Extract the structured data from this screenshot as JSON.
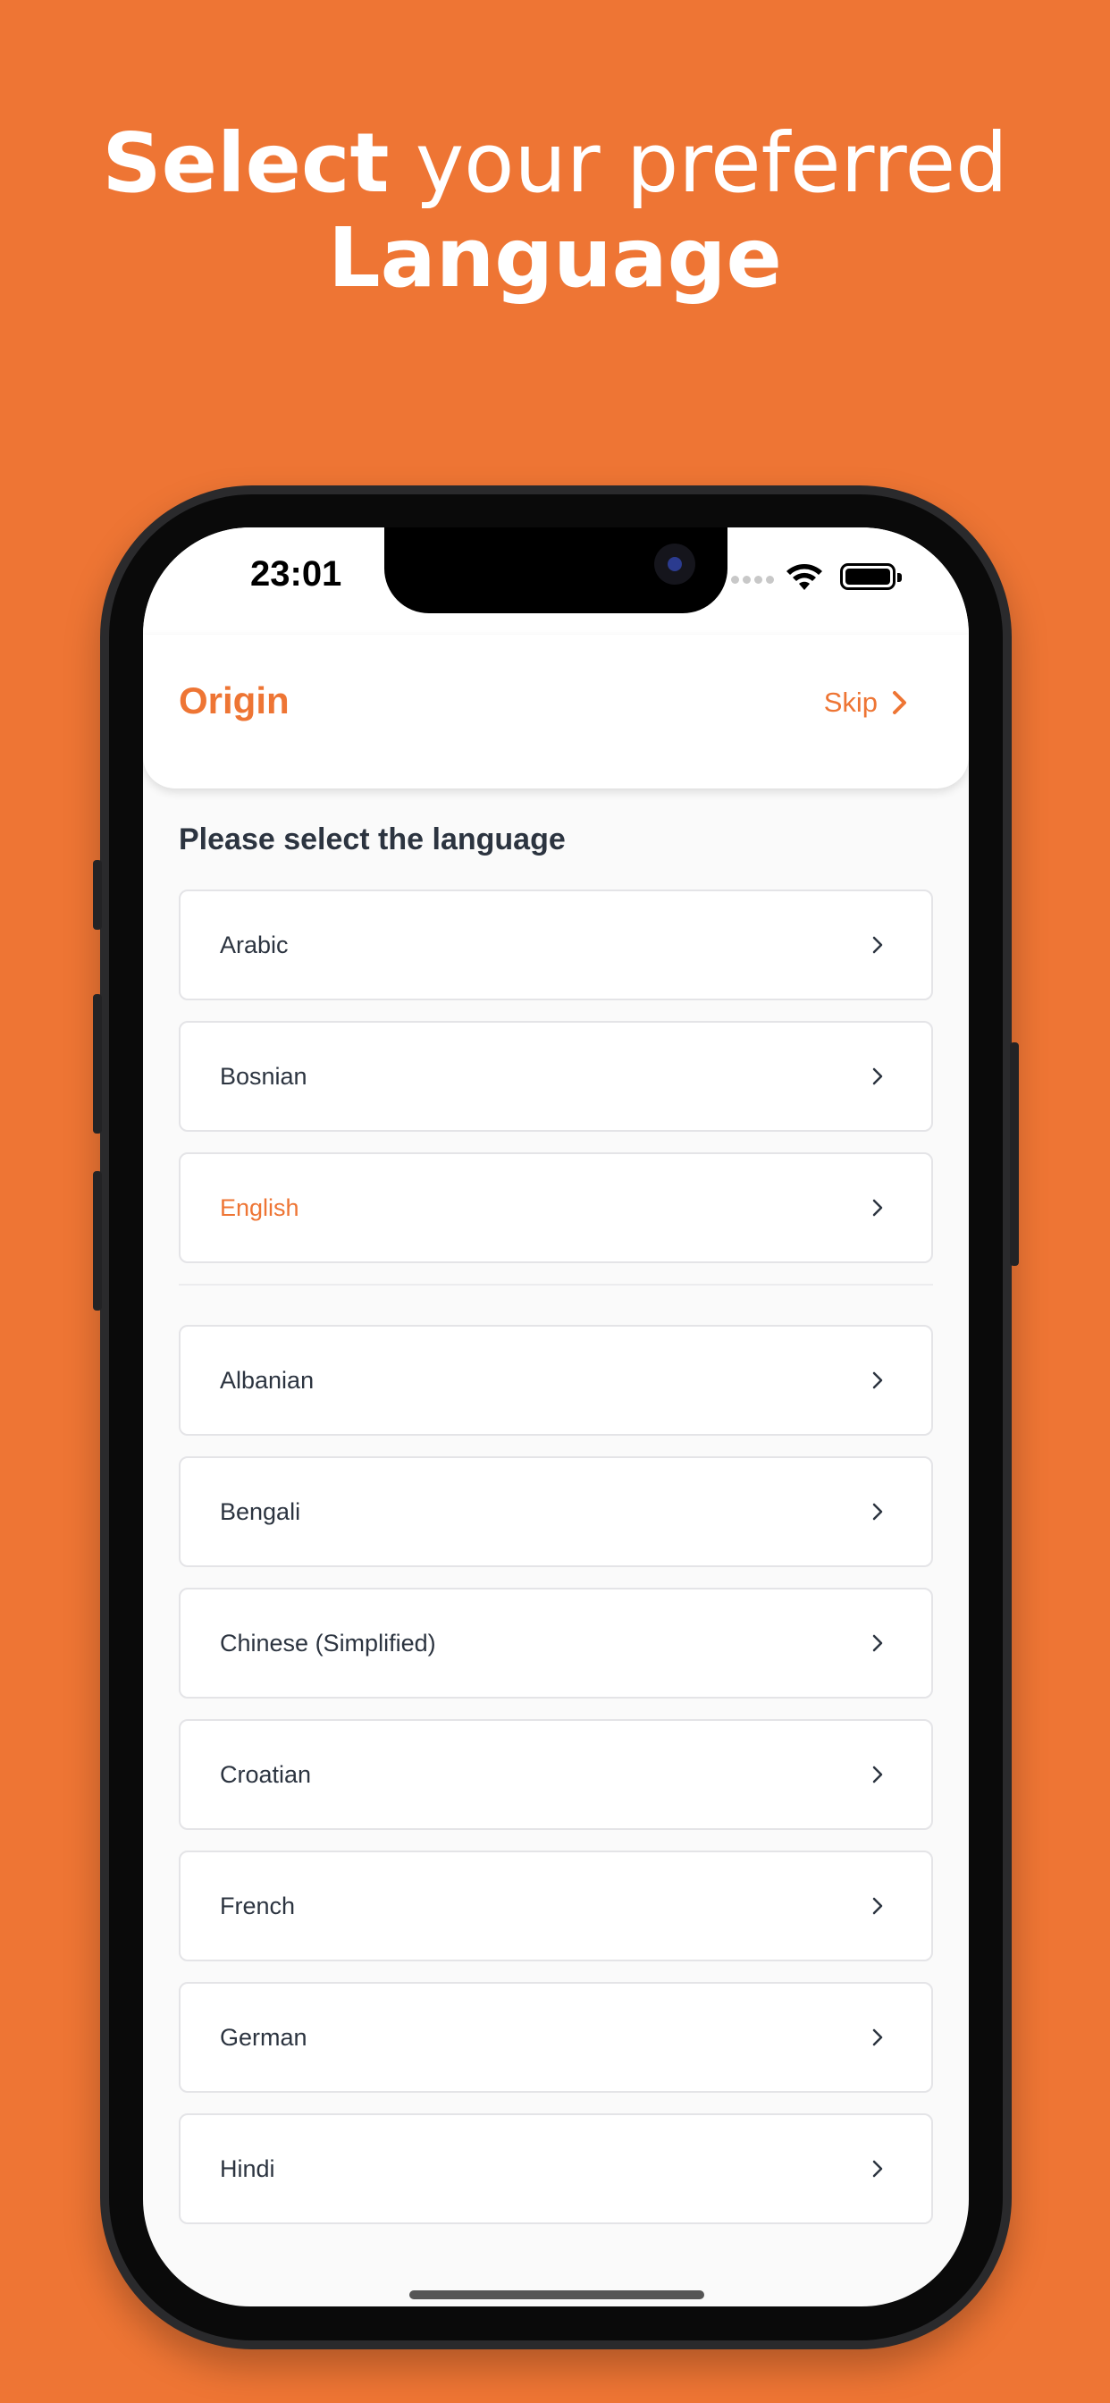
{
  "headline": {
    "line1_strong": "Select",
    "line1_light": " your preferred",
    "line2_strong": "Language"
  },
  "status_bar": {
    "time": "23:01",
    "icons": [
      "cellular-signal-icon",
      "wifi-icon",
      "battery-icon"
    ]
  },
  "app_bar": {
    "brand": "Origin",
    "skip_label": "Skip",
    "skip_icon": "chevron-right-icon"
  },
  "content": {
    "prompt": "Please select the language",
    "suggested_languages": [
      {
        "label": "Arabic",
        "selected": false
      },
      {
        "label": "Bosnian",
        "selected": false
      },
      {
        "label": "English",
        "selected": true
      }
    ],
    "all_languages": [
      {
        "label": "Albanian"
      },
      {
        "label": "Bengali"
      },
      {
        "label": "Chinese (Simplified)"
      },
      {
        "label": "Croatian"
      },
      {
        "label": "French"
      },
      {
        "label": "German"
      },
      {
        "label": "Hindi"
      }
    ]
  },
  "colors": {
    "background": "#EE7534",
    "accent": "#EE7534",
    "text": "#2c3440",
    "border": "#e4e4e7"
  }
}
